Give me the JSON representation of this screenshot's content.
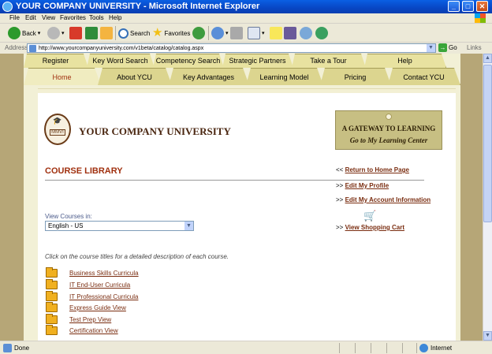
{
  "window": {
    "title": "YOUR COMPANY UNIVERSITY - Microsoft Internet Explorer",
    "min": "_",
    "max": "□",
    "close": "✕"
  },
  "menu": [
    "File",
    "Edit",
    "View",
    "Favorites",
    "Tools",
    "Help"
  ],
  "toolbar": {
    "back": "Back",
    "search": "Search",
    "favorites": "Favorites"
  },
  "address": {
    "label": "Address",
    "url": "http://www.yourcompanyuniversity.com/v1beta/catalog/catalog.aspx",
    "go": "Go",
    "links": "Links"
  },
  "nav": {
    "row1": [
      "Register",
      "Key Word Search",
      "Competency Search",
      "Strategic Partners",
      "Take a Tour",
      "Help"
    ],
    "row2": [
      "Home",
      "About YCU",
      "Key Advantages",
      "Learning Model",
      "Pricing",
      "Contact YCU"
    ],
    "active": "Home"
  },
  "logo": {
    "seal_text": "MMVI",
    "name": "YOUR COMPANY UNIVERSITY"
  },
  "gateway": {
    "line1": "A GATEWAY TO LEARNING",
    "line2": "Go to My Learning Center"
  },
  "library": {
    "title": "COURSE LIBRARY",
    "view_label": "View Courses in:",
    "language": "English - US",
    "intro": "Click on the course titles for a detailed description of each course.",
    "courses": [
      "Business Skills Curricula",
      "IT End-User Curricula",
      "IT Professional Curricula",
      "Express Guide View",
      "Test Prep View",
      "Certification View"
    ]
  },
  "side_links": {
    "home": {
      "prefix": "<<",
      "label": "Return to Home Page"
    },
    "profile": {
      "prefix": ">>",
      "label": "Edit My Profile"
    },
    "account": {
      "prefix": ">>",
      "label": "Edit My Account Information"
    },
    "cart": {
      "prefix": ">>",
      "label": "View Shopping Cart"
    }
  },
  "status": {
    "left": "Done",
    "zone": "Internet"
  },
  "colors": {
    "accent": "#a0300f",
    "link": "#7a2d10",
    "tab": "#e8e2a0",
    "frame": "#b6a677"
  }
}
